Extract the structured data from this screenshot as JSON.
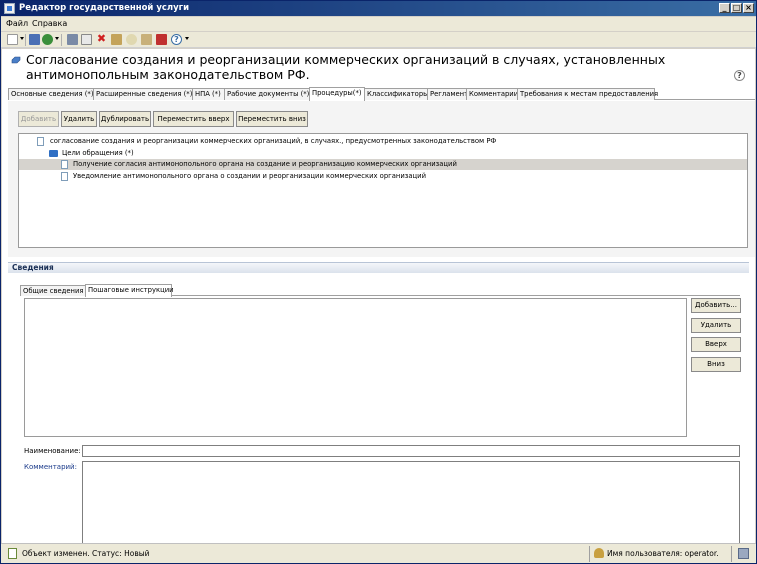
{
  "window": {
    "title": "Редактор государственной услуги",
    "controls": [
      "_",
      "□",
      "×"
    ]
  },
  "menu": {
    "items": [
      "Файл",
      "Справка"
    ]
  },
  "toolbar": {
    "icons": [
      "new-icon",
      "save-icon",
      "refresh-icon",
      "print-icon",
      "preview-icon",
      "delete-icon",
      "copy-icon",
      "search-icon",
      "paste-icon",
      "export-icon",
      "help-icon"
    ]
  },
  "page": {
    "title": "Согласование создания и реорганизации коммерческих организаций в случаях, установленных антимонопольным законодательством РФ.",
    "help_glyph": "?"
  },
  "tabs": [
    {
      "label": "Основные сведения (*)",
      "active": false
    },
    {
      "label": "Расширенные сведения (*)",
      "active": false
    },
    {
      "label": "НПА (*)",
      "active": false
    },
    {
      "label": "Рабочие документы (*)",
      "active": false
    },
    {
      "label": "Процедуры(*)",
      "active": true
    },
    {
      "label": "Классификаторы",
      "active": false
    },
    {
      "label": "Регламент",
      "active": false
    },
    {
      "label": "Комментарии",
      "active": false
    },
    {
      "label": "Требования к местам предоставления",
      "active": false
    }
  ],
  "procedures": {
    "buttons": [
      {
        "label": "Добавить",
        "enabled": false
      },
      {
        "label": "Удалить",
        "enabled": true
      },
      {
        "label": "Дублировать",
        "enabled": true
      },
      {
        "label": "Переместить вверх",
        "enabled": true
      },
      {
        "label": "Переместить вниз",
        "enabled": true
      }
    ],
    "tree": {
      "root": "согласование создания и реорганизации коммерческих организаций, в случаях., предусмотренных законодательством РФ",
      "group": "Цели обращения (*)",
      "items": [
        {
          "label": "Получение согласия  антимонопольного органа на  создание и реорганизацию коммерческих организаций",
          "selected": true
        },
        {
          "label": "Уведомление антимонопольного органа о создании и реорганизации коммерческих организаций",
          "selected": false
        }
      ]
    }
  },
  "details": {
    "header": "Сведения",
    "tabs": [
      {
        "label": "Общие сведения",
        "active": false
      },
      {
        "label": "Пошаговые инструкции",
        "active": true
      }
    ],
    "side_buttons": [
      "Добавить...",
      "Удалить",
      "Вверх",
      "Вниз"
    ],
    "name_label": "Наименование:",
    "name_value": "",
    "comment_label": "Комментарий:",
    "comment_value": ""
  },
  "status": {
    "left": "Объект изменен. Статус: Новый",
    "user": "Имя пользователя: operator."
  }
}
